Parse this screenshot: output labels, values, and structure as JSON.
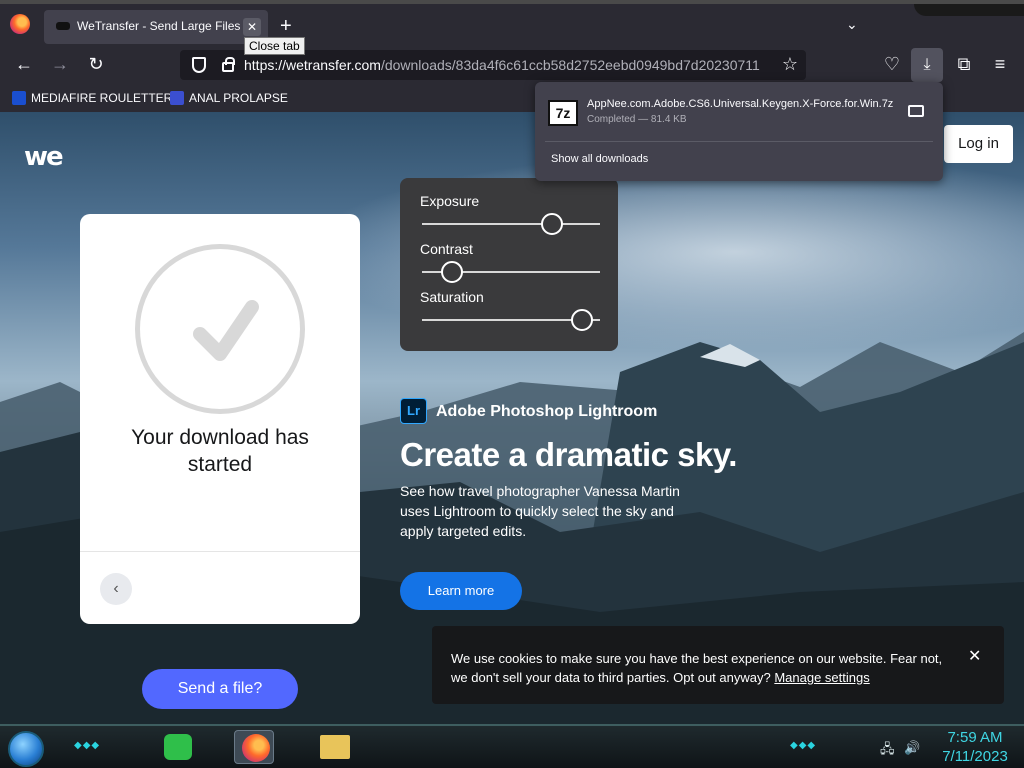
{
  "browser": {
    "tab_title": "WeTransfer - Send Large Files &",
    "tab_close_tooltip": "Close tab",
    "url_host": "https://wetransfer.com",
    "url_path": "/downloads/83da4f6c61ccb58d2752eebd0949bd7d20230711",
    "bookmarks": [
      {
        "label": "MEDIAFIRE ROULETTER",
        "icon": "mediafire-icon"
      },
      {
        "label": "ANAL PROLAPSE",
        "icon": "sigma-icon"
      }
    ]
  },
  "downloads_panel": {
    "file_name": "AppNee.com.Adobe.CS6.Universal.Keygen.X-Force.for.Win.7z",
    "file_icon_text": "7z",
    "status": "Completed — 81.4 KB",
    "show_all": "Show all downloads"
  },
  "page": {
    "logo": "we",
    "login": "Log in",
    "card": {
      "message": "Your download has started",
      "send_button": "Send a file?"
    },
    "edit_panel": {
      "sliders": [
        {
          "label": "Exposure",
          "value": 0.73
        },
        {
          "label": "Contrast",
          "value": 0.17
        },
        {
          "label": "Saturation",
          "value": 0.9
        }
      ]
    },
    "promo": {
      "logo_text": "Lr",
      "brand": "Adobe Photoshop Lightroom",
      "title": "Create a dramatic sky.",
      "text": "See how travel photographer Vanessa Martin uses Lightroom to quickly select the sky and apply targeted edits.",
      "button": "Learn more"
    },
    "cookie": {
      "text": "We use cookies to make sure you have the best experience on our website. Fear not, we don't sell your data to third parties. Opt out anyway?",
      "link": "Manage settings"
    }
  },
  "taskbar": {
    "time": "7:59 AM",
    "date": "7/11/2023",
    "accent_color": "#3fd6e3"
  }
}
